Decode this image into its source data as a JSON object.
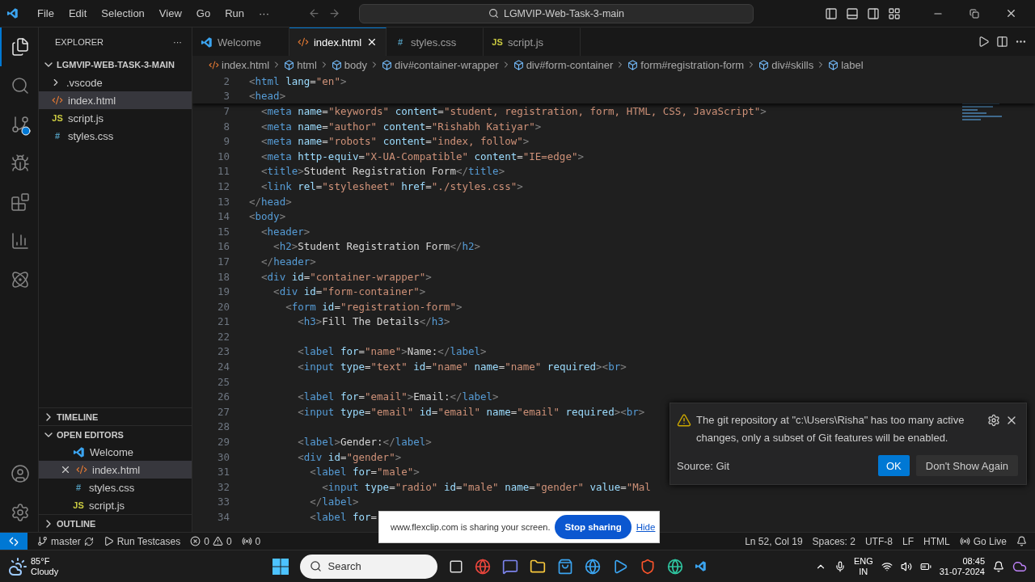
{
  "title_bar": {
    "menu": [
      "File",
      "Edit",
      "Selection",
      "View",
      "Go",
      "Run"
    ],
    "more": "···",
    "search": "LGMVIP-Web-Task-3-main"
  },
  "activity_bar": [
    {
      "kind": "files",
      "selected": true
    },
    {
      "kind": "search",
      "selected": false
    },
    {
      "kind": "source-control",
      "selected": false
    },
    {
      "kind": "debug",
      "selected": false
    },
    {
      "kind": "extensions",
      "selected": false
    },
    {
      "kind": "chart",
      "selected": false
    },
    {
      "kind": "atom",
      "selected": false
    }
  ],
  "sidebar": {
    "title": "EXPLORER",
    "more": "···",
    "folder": {
      "label": "LGMVIP-WEB-TASK-3-MAIN",
      "expanded": true,
      "items": [
        {
          "label": ".vscode",
          "kind": "folder",
          "selected": false
        },
        {
          "label": "index.html",
          "kind": "html",
          "selected": true
        },
        {
          "label": "script.js",
          "kind": "js",
          "glyph": "JS",
          "selected": false
        },
        {
          "label": "styles.css",
          "kind": "css",
          "glyph": "#",
          "selected": false
        }
      ]
    },
    "timeline": {
      "label": "TIMELINE",
      "expanded": false
    },
    "open_editors": {
      "label": "OPEN EDITORS",
      "expanded": true,
      "items": [
        {
          "label": "Welcome",
          "kind": "vscode",
          "selected": false
        },
        {
          "label": "index.html",
          "kind": "html",
          "selected": true
        },
        {
          "label": "styles.css",
          "kind": "css",
          "glyph": "#",
          "selected": false
        },
        {
          "label": "script.js",
          "kind": "js",
          "glyph": "JS",
          "selected": false
        }
      ]
    },
    "outline": {
      "label": "OUTLINE",
      "expanded": false
    }
  },
  "tabs": [
    {
      "label": "Welcome",
      "kind": "vscode",
      "selected": false
    },
    {
      "label": "index.html",
      "kind": "html",
      "selected": true
    },
    {
      "label": "styles.css",
      "kind": "css",
      "glyph": "#",
      "selected": false
    },
    {
      "label": "script.js",
      "kind": "js",
      "glyph": "JS",
      "selected": false
    }
  ],
  "breadcrumb": [
    {
      "label": "index.html",
      "kind": "file"
    },
    {
      "label": "html",
      "kind": "element"
    },
    {
      "label": "body",
      "kind": "element"
    },
    {
      "label": "div#container-wrapper",
      "kind": "element"
    },
    {
      "label": "div#form-container",
      "kind": "element"
    },
    {
      "label": "form#registration-form",
      "kind": "element"
    },
    {
      "label": "div#skills",
      "kind": "element"
    },
    {
      "label": "label",
      "kind": "element"
    }
  ],
  "sticky_lines": [
    {
      "number": "2",
      "text": "<html lang=\"en\">"
    },
    {
      "number": "3",
      "text": "<head>"
    }
  ],
  "code_lines": [
    {
      "number": "7",
      "text": "  <meta name=\"keywords\" content=\"student, registration, form, HTML, CSS, JavaScript\">"
    },
    {
      "number": "8",
      "text": "  <meta name=\"author\" content=\"Rishabh Katiyar\">"
    },
    {
      "number": "9",
      "text": "  <meta name=\"robots\" content=\"index, follow\">"
    },
    {
      "number": "10",
      "text": "  <meta http-equiv=\"X-UA-Compatible\" content=\"IE=edge\">"
    },
    {
      "number": "11",
      "text": "  <title>Student Registration Form</title>"
    },
    {
      "number": "12",
      "text": "  <link rel=\"stylesheet\" href=\"./styles.css\">"
    },
    {
      "number": "13",
      "text": "</head>"
    },
    {
      "number": "14",
      "text": "<body>"
    },
    {
      "number": "15",
      "text": "  <header>"
    },
    {
      "number": "16",
      "text": "    <h2>Student Registration Form</h2>"
    },
    {
      "number": "17",
      "text": "  </header>"
    },
    {
      "number": "18",
      "text": "  <div id=\"container-wrapper\">"
    },
    {
      "number": "19",
      "text": "    <div id=\"form-container\">"
    },
    {
      "number": "20",
      "text": "      <form id=\"registration-form\">"
    },
    {
      "number": "21",
      "text": "        <h3>Fill The Details</h3>"
    },
    {
      "number": "22"
    },
    {
      "number": "23",
      "text": "        <label for=\"name\">Name:</label>"
    },
    {
      "number": "24",
      "text": "        <input type=\"text\" id=\"name\" name=\"name\" required><br>"
    },
    {
      "number": "25"
    },
    {
      "number": "26",
      "text": "        <label for=\"email\">Email:</label>"
    },
    {
      "number": "27",
      "text": "        <input type=\"email\" id=\"email\" name=\"email\" required><br>"
    },
    {
      "number": "28"
    },
    {
      "number": "29",
      "text": "        <label>Gender:</label>"
    },
    {
      "number": "30",
      "text": "        <div id=\"gender\">"
    },
    {
      "number": "31",
      "text": "          <label for=\"male\">"
    },
    {
      "number": "32",
      "text": "            <input type=\"radio\" id=\"male\" name=\"gender\" value=\"Mal"
    },
    {
      "number": "33",
      "text": "          </label>"
    },
    {
      "number": "34",
      "text": "          <label for="
    }
  ],
  "notification": {
    "message": "The git repository at \"c:\\Users\\Risha\" has too many active changes, only a subset of Git features will be enabled.",
    "source": "Source: Git",
    "buttons": [
      {
        "label": "OK",
        "kind": "primary"
      },
      {
        "label": "Don't Show Again",
        "kind": "secondary"
      }
    ]
  },
  "share_banner": {
    "message": "www.flexclip.com is sharing your screen.",
    "stop": "Stop sharing",
    "hide": "Hide"
  },
  "status_bar": {
    "branch": "master",
    "run": "Run Testcases",
    "errors": "0",
    "warnings": "0",
    "ports": "0",
    "right": [
      "Ln 52, Col 19",
      "Spaces: 2",
      "UTF-8",
      "LF",
      "HTML"
    ],
    "live": "Go Live"
  },
  "taskbar": {
    "temperature": "85°F",
    "weather": "Cloudy",
    "search": "Search",
    "language": "ENG",
    "region": "IN",
    "time": "08:45",
    "date": "31-07-2024"
  }
}
